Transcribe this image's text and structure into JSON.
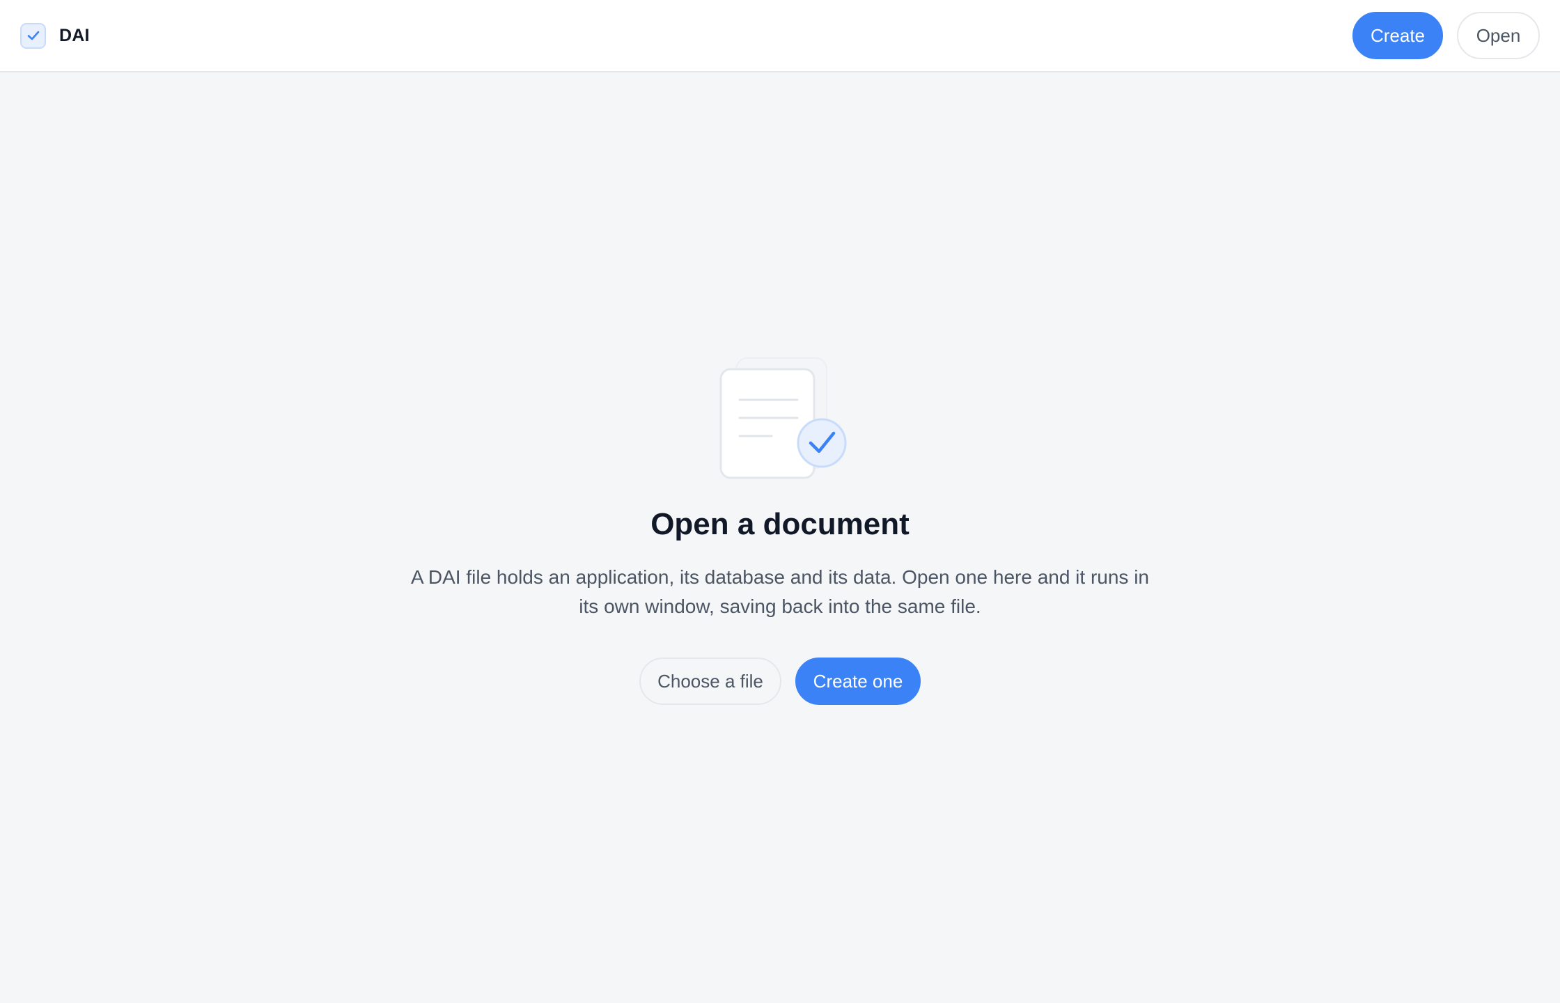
{
  "header": {
    "app_name": "DAI",
    "create_label": "Create",
    "open_label": "Open"
  },
  "empty_state": {
    "title": "Open a document",
    "description": "A DAI file holds an application, its database and its data. Open one here and it runs in its own window, saving back into the same file.",
    "choose_label": "Choose a file",
    "create_label": "Create one"
  },
  "icons": {
    "brand": "check-square-icon",
    "illustration": "document-check-icon"
  },
  "colors": {
    "accent": "#3b82f6",
    "background": "#f5f6f8",
    "header_bg": "#ffffff",
    "text_primary": "#111827",
    "text_secondary": "#4b5563"
  }
}
